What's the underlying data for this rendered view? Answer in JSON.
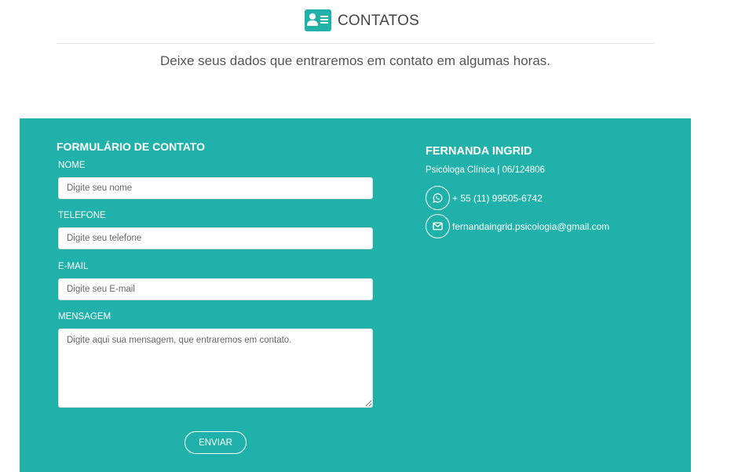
{
  "header": {
    "title": "CONTATOS",
    "subtitle": "Deixe seus dados que entraremos em contato em algumas horas.",
    "icon": "contact-card-icon"
  },
  "form": {
    "title": "FORMULÁRIO DE CONTATO",
    "fields": [
      {
        "label": "NOME",
        "placeholder": "Digite seu nome"
      },
      {
        "label": "TELEFONE",
        "placeholder": "Digite seu telefone"
      },
      {
        "label": "E-MAIL",
        "placeholder": "Digite seu E-mail"
      }
    ],
    "message": {
      "label": "MENSAGEM",
      "placeholder": "Digite aqui sua mensagem, que entraremos em contato."
    },
    "submit_label": "ENVIAR"
  },
  "info": {
    "name": "FERNANDA INGRID",
    "role": "Psicóloga Clínica | 06/124806",
    "phone": "+ 55 (11) 99505-6742",
    "phone_icon": "whatsapp-icon",
    "email": "fernandaingrid.psicologia@gmail.com",
    "email_icon": "envelope-icon"
  },
  "colors": {
    "accent": "#20b2aa",
    "text": "#444444",
    "on_accent": "#ffffff"
  }
}
